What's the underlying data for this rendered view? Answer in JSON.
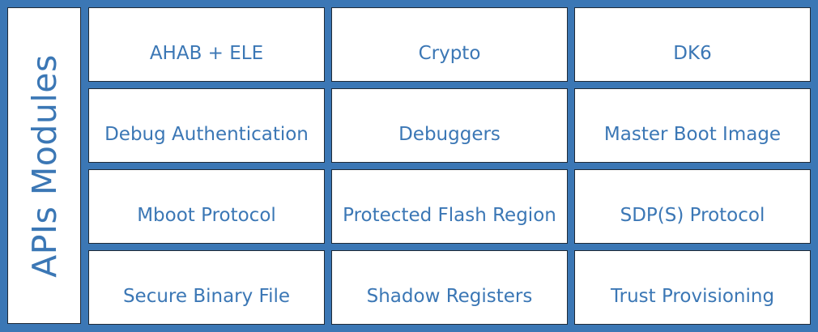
{
  "sidebar": {
    "title": "APIs Modules"
  },
  "modules": [
    {
      "label": "AHAB + ELE"
    },
    {
      "label": "Crypto"
    },
    {
      "label": "DK6"
    },
    {
      "label": "Debug Authentication"
    },
    {
      "label": "Debuggers"
    },
    {
      "label": "Master Boot Image"
    },
    {
      "label": "Mboot Protocol"
    },
    {
      "label": "Protected Flash Region"
    },
    {
      "label": "SDP(S) Protocol"
    },
    {
      "label": "Secure Binary File"
    },
    {
      "label": "Shadow Registers"
    },
    {
      "label": "Trust Provisioning"
    }
  ],
  "colors": {
    "background": "#3b77b5",
    "text": "#3b77b5",
    "box": "#ffffff",
    "border": "#1f2a36"
  }
}
